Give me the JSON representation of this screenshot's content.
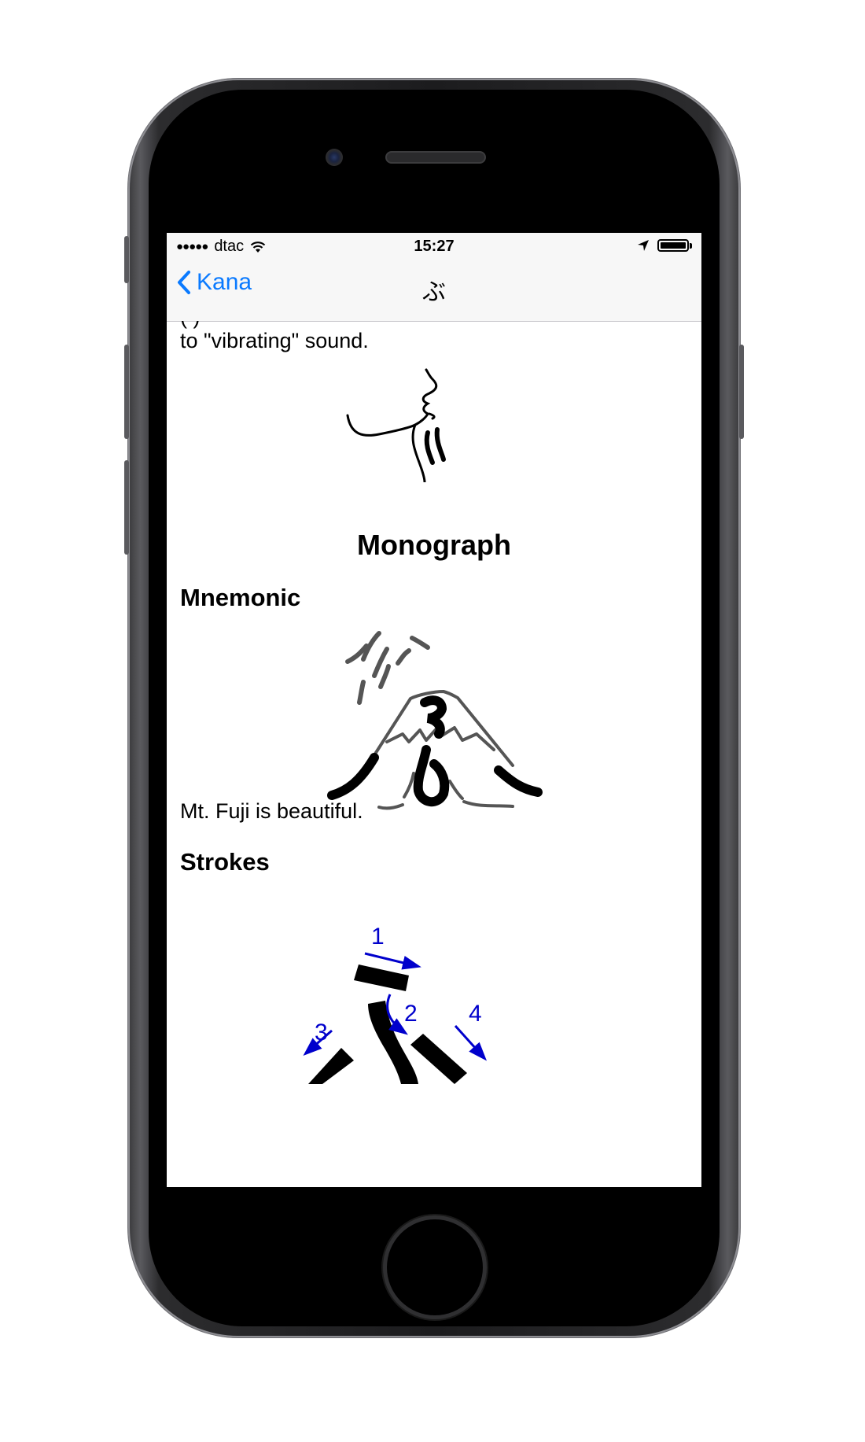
{
  "statusbar": {
    "carrier": "dtac",
    "time": "15:27",
    "signal_icon": "signal-dots-icon",
    "wifi_icon": "wifi-icon",
    "location_icon": "location-arrow-icon",
    "battery_icon": "battery-icon"
  },
  "navbar": {
    "back_label": "Kana",
    "title": "ぶ"
  },
  "content": {
    "clipped_text": "(          )                 ",
    "paragraph_end": "to \"vibrating\" sound.",
    "monograph_title": "Monograph",
    "mnemonic_heading": "Mnemonic",
    "mnemonic_text": "Mt. Fuji is beautiful.",
    "strokes_heading": "Strokes",
    "stroke_numbers": [
      "1",
      "2",
      "3",
      "4"
    ]
  },
  "colors": {
    "accent": "#0a7aff",
    "stroke_arrow": "#0000cc"
  }
}
